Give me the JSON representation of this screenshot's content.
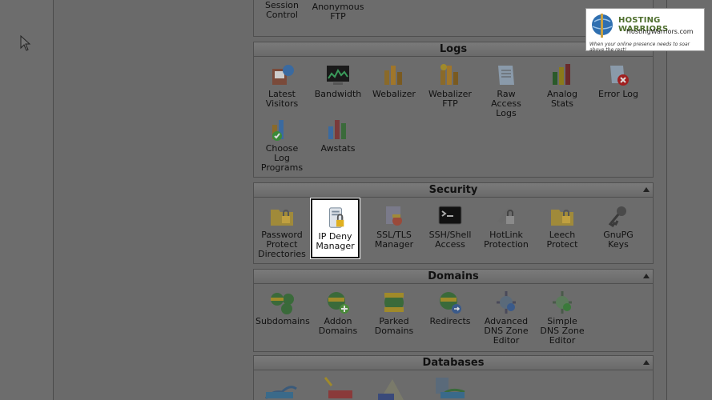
{
  "top_items": [
    {
      "label": "FTP\nSession\nControl",
      "icon": "ftp-session-icon"
    },
    {
      "label": "Anonymous\nFTP",
      "icon": "anonymous-ftp-icon"
    }
  ],
  "sections": {
    "logs": {
      "title": "Logs",
      "items": [
        {
          "label": "Latest\nVisitors"
        },
        {
          "label": "Bandwidth"
        },
        {
          "label": "Webalizer"
        },
        {
          "label": "Webalizer\nFTP"
        },
        {
          "label": "Raw\nAccess\nLogs"
        },
        {
          "label": "Analog\nStats"
        },
        {
          "label": "Error Log"
        },
        {
          "label": "Choose\nLog\nPrograms"
        },
        {
          "label": "Awstats"
        }
      ]
    },
    "security": {
      "title": "Security",
      "items": [
        {
          "label": "Password\nProtect\nDirectories"
        },
        {
          "label": "IP Deny\nManager"
        },
        {
          "label": "SSL/TLS\nManager"
        },
        {
          "label": "SSH/Shell\nAccess"
        },
        {
          "label": "HotLink\nProtection"
        },
        {
          "label": "Leech\nProtect"
        },
        {
          "label": "GnuPG\nKeys"
        }
      ]
    },
    "domains": {
      "title": "Domains",
      "items": [
        {
          "label": "Subdomains"
        },
        {
          "label": "Addon\nDomains"
        },
        {
          "label": "Parked\nDomains"
        },
        {
          "label": "Redirects"
        },
        {
          "label": "Advanced\nDNS Zone\nEditor"
        },
        {
          "label": "Simple\nDNS Zone\nEditor"
        }
      ]
    },
    "databases": {
      "title": "Databases"
    }
  },
  "logo": {
    "title": "HOSTING WARRIORS",
    "site": "HostingWarriors.com",
    "tagline": "When your online presence needs to soar above the rest!"
  }
}
